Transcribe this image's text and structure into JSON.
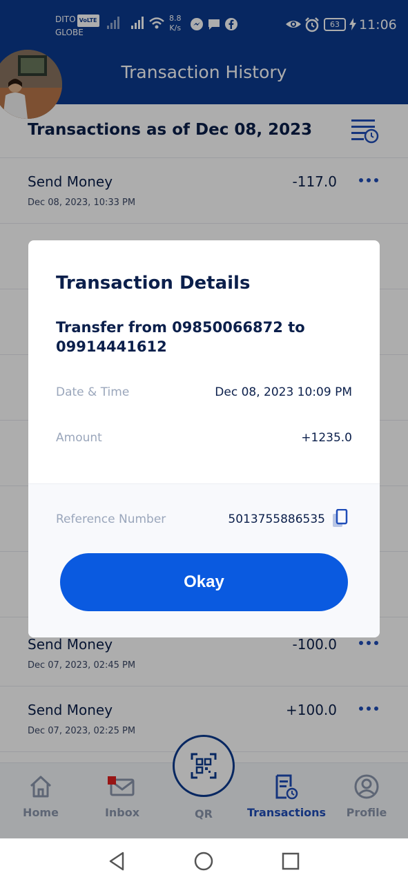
{
  "status_bar": {
    "carrier_1": "DITO",
    "carrier_badge": "VoLTE",
    "carrier_2": "GLOBE",
    "speed_value": "8.8",
    "speed_unit": "K/s",
    "battery": "63",
    "time": "11:06"
  },
  "header": {
    "title": "Transaction History"
  },
  "list": {
    "heading": "Transactions as of Dec 08, 2023",
    "transactions": [
      {
        "name": "Send Money",
        "date": "Dec 08, 2023, 10:33 PM",
        "amount": "-117.0"
      },
      {
        "name": "Send Money",
        "date": "Dec 07, 2023, 02:45 PM",
        "amount": "-100.0"
      },
      {
        "name": "Send Money",
        "date": "Dec 07, 2023, 02:25 PM",
        "amount": "+100.0"
      }
    ]
  },
  "modal": {
    "title": "Transaction Details",
    "description": "Transfer from 09850066872 to 09914441612",
    "date_label": "Date & Time",
    "date_value": "Dec 08, 2023 10:09 PM",
    "amount_label": "Amount",
    "amount_value": "+1235.0",
    "ref_label": "Reference Number",
    "ref_value": "5013755886535",
    "okay_label": "Okay"
  },
  "bottom_nav": {
    "items": [
      {
        "label": "Home",
        "icon": "home-icon"
      },
      {
        "label": "Inbox",
        "icon": "mail-icon"
      },
      {
        "label": "QR",
        "icon": "qr-scan-icon"
      },
      {
        "label": "Transactions",
        "icon": "transactions-icon",
        "active": true
      },
      {
        "label": "Profile",
        "icon": "profile-icon"
      }
    ]
  },
  "colors": {
    "header_bg": "#0b3a8f",
    "primary": "#0a5ae0",
    "active_nav": "#1f4db8",
    "text_dark": "#0b1f4b"
  }
}
